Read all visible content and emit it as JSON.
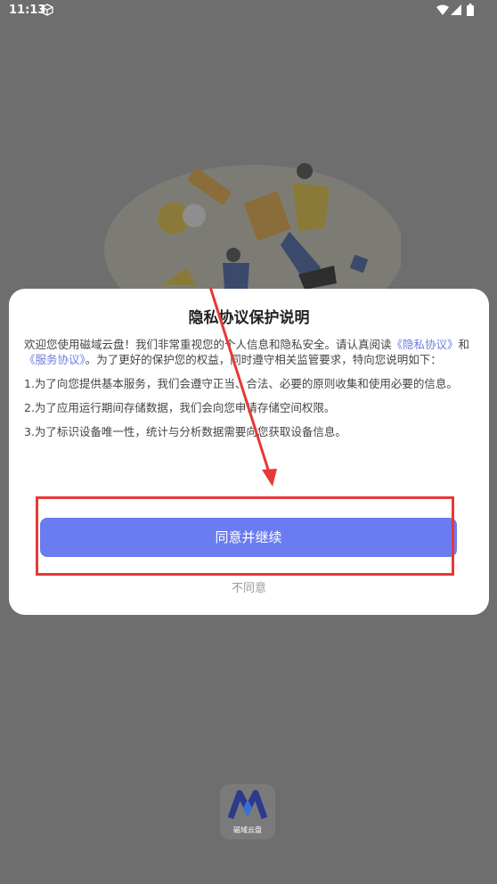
{
  "status_bar": {
    "time": "11:13"
  },
  "dialog": {
    "title": "隐私协议保护说明",
    "intro_text_1": "欢迎您使用磁域云盘！我们非常重视您的个人信息和隐私安全。请认真阅读",
    "link_privacy": "《隐私协议》",
    "intro_and": "和",
    "link_service": "《服务协议》",
    "intro_text_2": "。为了更好的保护您的权益，同时遵守相关监管要求，特向您说明如下：",
    "item1": "1.为了向您提供基本服务，我们会遵守正当、合法、必要的原则收集和使用必要的信息。",
    "item2": "2.为了应用运行期间存储数据，我们会向您申请存储空间权限。",
    "item3": "3.为了标识设备唯一性，统计与分析数据需要向您获取设备信息。",
    "agree_label": "同意并继续",
    "disagree_label": "不同意"
  },
  "app_logo": {
    "text": "磁域云盘"
  },
  "colors": {
    "overlay": "#6e6e6e",
    "primary": "#6a7cf0",
    "link": "#6b7ce0",
    "annotation": "#e53935"
  }
}
